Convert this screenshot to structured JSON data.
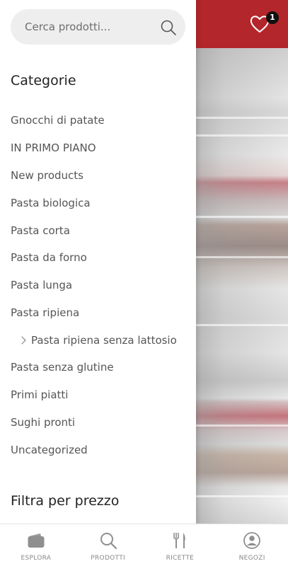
{
  "header": {
    "wishlist_count": "1",
    "brand_color": "#b3262b"
  },
  "search": {
    "placeholder": "Cerca prodotti...",
    "icon": "search-icon"
  },
  "categories": {
    "title": "Categorie",
    "items": [
      {
        "label": "Gnocchi di patate"
      },
      {
        "label": "IN PRIMO PIANO"
      },
      {
        "label": "New products"
      },
      {
        "label": "Pasta biologica"
      },
      {
        "label": "Pasta corta"
      },
      {
        "label": "Pasta da forno"
      },
      {
        "label": "Pasta lunga"
      },
      {
        "label": "Pasta ripiena"
      },
      {
        "label": "Pasta ripiena senza lattosio",
        "subcategory": true
      },
      {
        "label": "Pasta senza glutine"
      },
      {
        "label": "Primi piatti"
      },
      {
        "label": "Sughi pronti"
      },
      {
        "label": "Uncategorized"
      }
    ]
  },
  "filter": {
    "title": "Filtra per prezzo"
  },
  "bottom_nav": {
    "items": [
      {
        "label": "ESPLORA",
        "icon": "wallet-icon"
      },
      {
        "label": "PRODOTTI",
        "icon": "search-icon"
      },
      {
        "label": "RICETTE",
        "icon": "fork-knife-icon"
      },
      {
        "label": "NEGOZI",
        "icon": "store-user-icon"
      }
    ]
  }
}
